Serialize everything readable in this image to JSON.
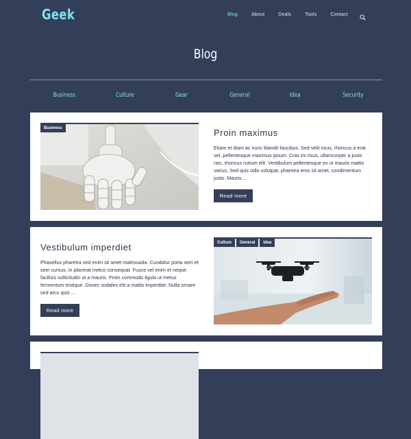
{
  "site": {
    "logo": "Geek"
  },
  "nav": {
    "items": [
      {
        "label": "Blog",
        "active": true
      },
      {
        "label": "About",
        "active": false
      },
      {
        "label": "Deals",
        "active": false
      },
      {
        "label": "Tools",
        "active": false
      },
      {
        "label": "Contact",
        "active": false
      }
    ],
    "search_icon": "search-icon"
  },
  "page": {
    "title": "Blog"
  },
  "categories": [
    "Business",
    "Culture",
    "Gear",
    "General",
    "Idea",
    "Security"
  ],
  "posts": [
    {
      "title": "Proin maximus",
      "tags": [
        "Business"
      ],
      "excerpt": "Etiam et diam ac nunc blandit faucibus. Sed velit risus, rhoncus a erat vel, pellentesque maximus ipsum. Cras ex risus, ullamcorper a justo nec, rhoncus rutrum elit. Vestibulum pellentesque ex ut mauris mattis varius. Sed quis odio volutpat, pharetra eros sit amet, condimentum justo. Mauris ...",
      "button": "Read more"
    },
    {
      "title": "Vestibulum imperdiet",
      "tags": [
        "Culture",
        "General",
        "Idea"
      ],
      "excerpt": "Phasellus pharetra sed enim sit amet malesuada. Curabitur porta sem et sem cursus, in placerat metus consequat. Fusce vel enim et neque facilisis sollicitudin ut a mauris. Proin commodo ligula ut metus fermentum tristique. Donec sodales elit a mattis imperdiet. Nulla ornare sed arcu quis ...",
      "button": "Read more"
    }
  ],
  "colors": {
    "background": "#333f58",
    "accent": "#7fe3f0",
    "card": "#ffffff",
    "text": "#2b3246"
  }
}
